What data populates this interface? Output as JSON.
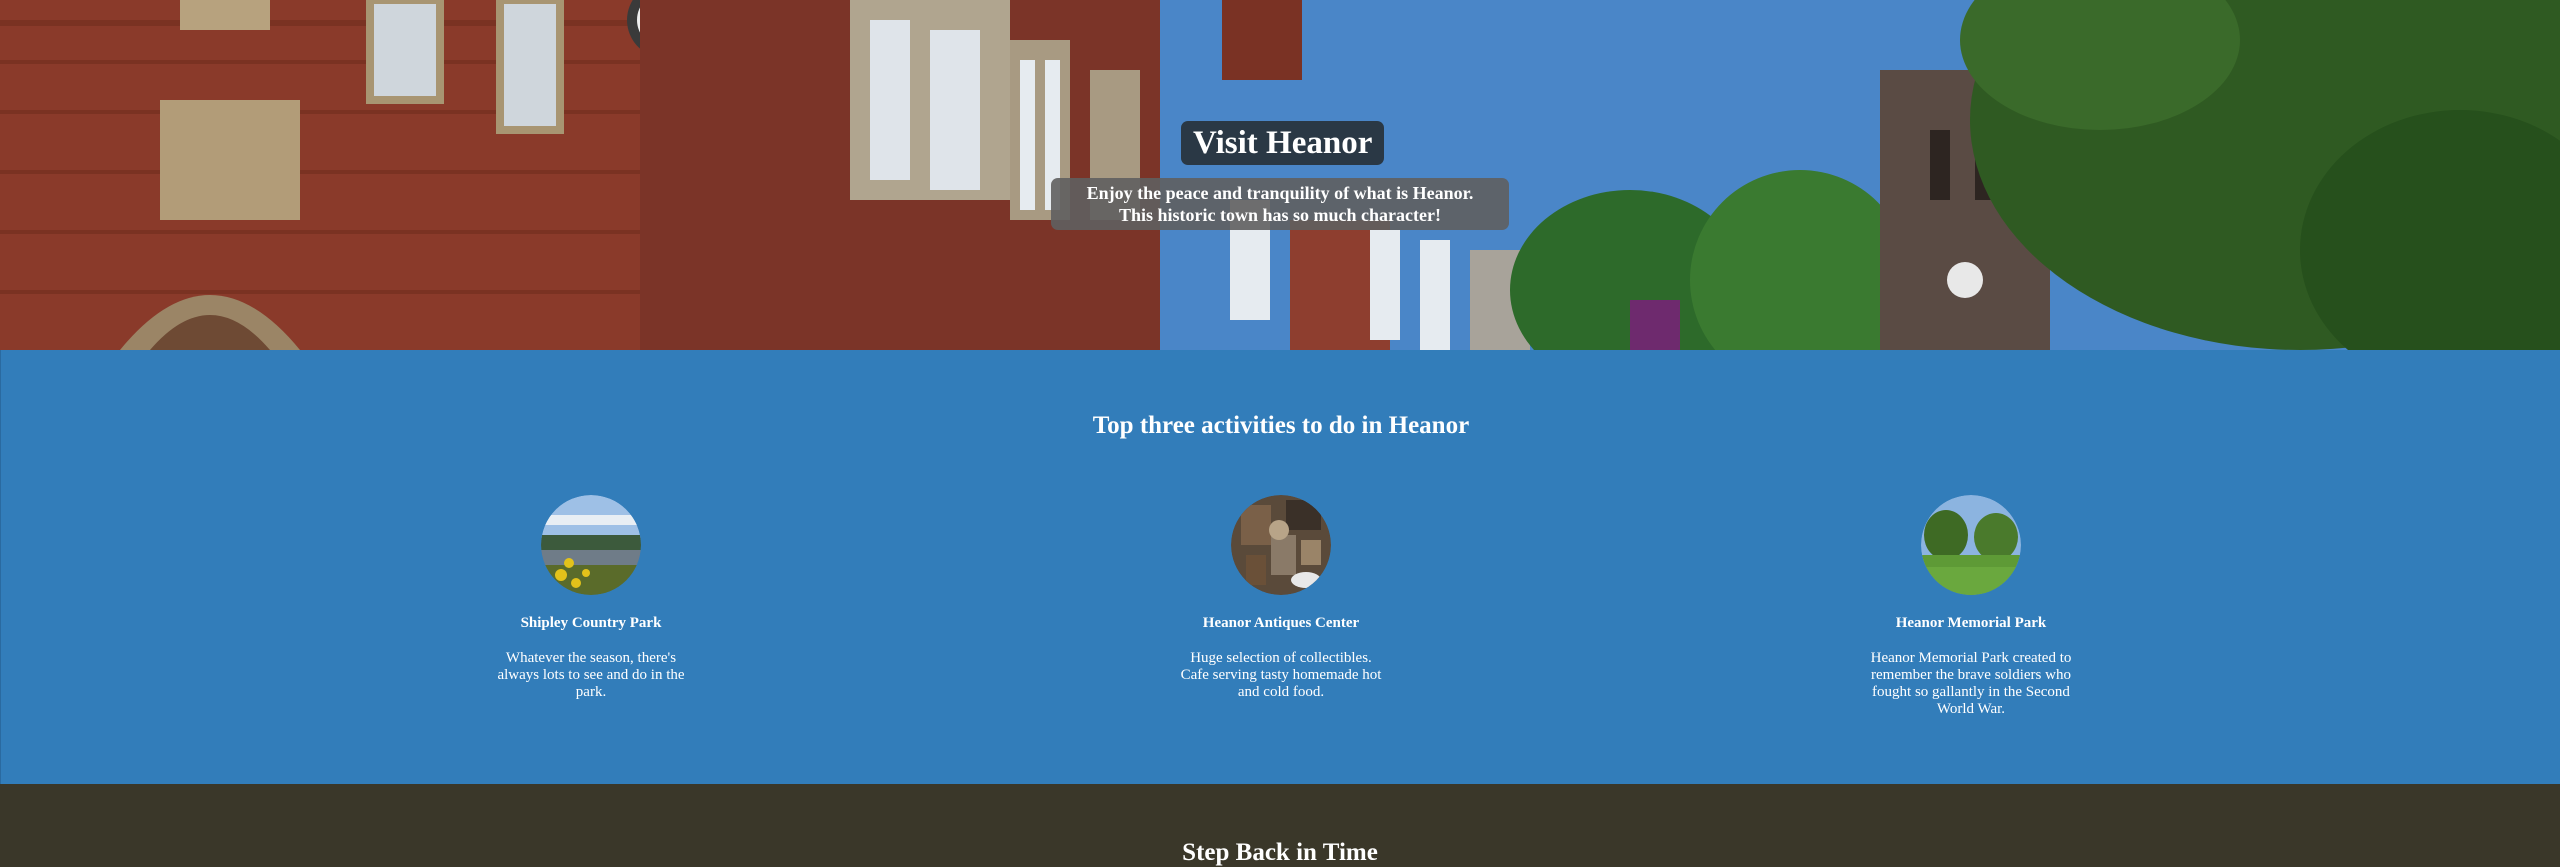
{
  "hero": {
    "title": "Visit Heanor",
    "subtitle_line1": "Enjoy the peace and tranquility of what is Heanor.",
    "subtitle_line2": "This historic town has so much character!"
  },
  "activities": {
    "heading": "Top three activities to do in Heanor",
    "items": [
      {
        "name": "Shipley Country Park",
        "description": "Whatever the season, there's always lots to see and do in the park.",
        "image": "lake-with-yellow-flowers"
      },
      {
        "name": "Heanor Antiques Center",
        "description": "Huge selection of collectibles. Cafe serving tasty homemade hot and cold food.",
        "image": "antique-shop-interior"
      },
      {
        "name": "Heanor Memorial Park",
        "description": "Heanor Memorial Park created to remember the brave soldiers who fought so gallantly in the Second World War.",
        "image": "park-trees-and-lawn"
      }
    ]
  },
  "history": {
    "heading": "Step Back in Time"
  },
  "colors": {
    "activities_bg": "#327dba",
    "history_bg": "#3a3729",
    "text": "#ffffff"
  }
}
